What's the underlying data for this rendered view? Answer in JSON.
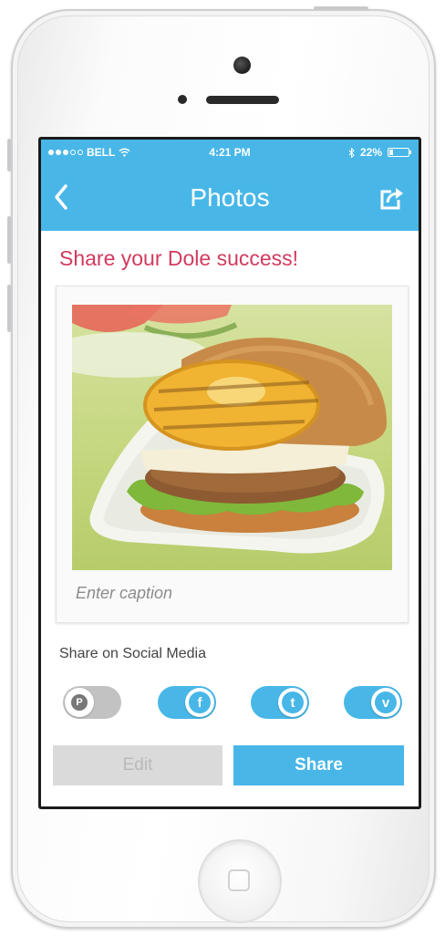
{
  "status_bar": {
    "carrier": "BELL",
    "time": "4:21 PM",
    "battery": "22%",
    "battery_level": 0.22
  },
  "nav": {
    "title": "Photos",
    "back_icon": "chevron-left-icon",
    "action_icon": "share-icon"
  },
  "headline": "Share your Dole success!",
  "photo": {
    "subject": "grilled pineapple burger"
  },
  "caption": {
    "placeholder": "Enter caption"
  },
  "social": {
    "label": "Share on Social Media",
    "toggles": [
      {
        "network": "pinterest",
        "glyph": "P",
        "on": false
      },
      {
        "network": "facebook",
        "glyph": "f",
        "on": true
      },
      {
        "network": "twitter",
        "glyph": "t",
        "on": true
      },
      {
        "network": "vine",
        "glyph": "v",
        "on": true
      }
    ]
  },
  "buttons": {
    "edit": "Edit",
    "share": "Share"
  },
  "colors": {
    "accent": "#48b7e8",
    "headline": "#d23a5e",
    "disabled": "#dadada"
  }
}
